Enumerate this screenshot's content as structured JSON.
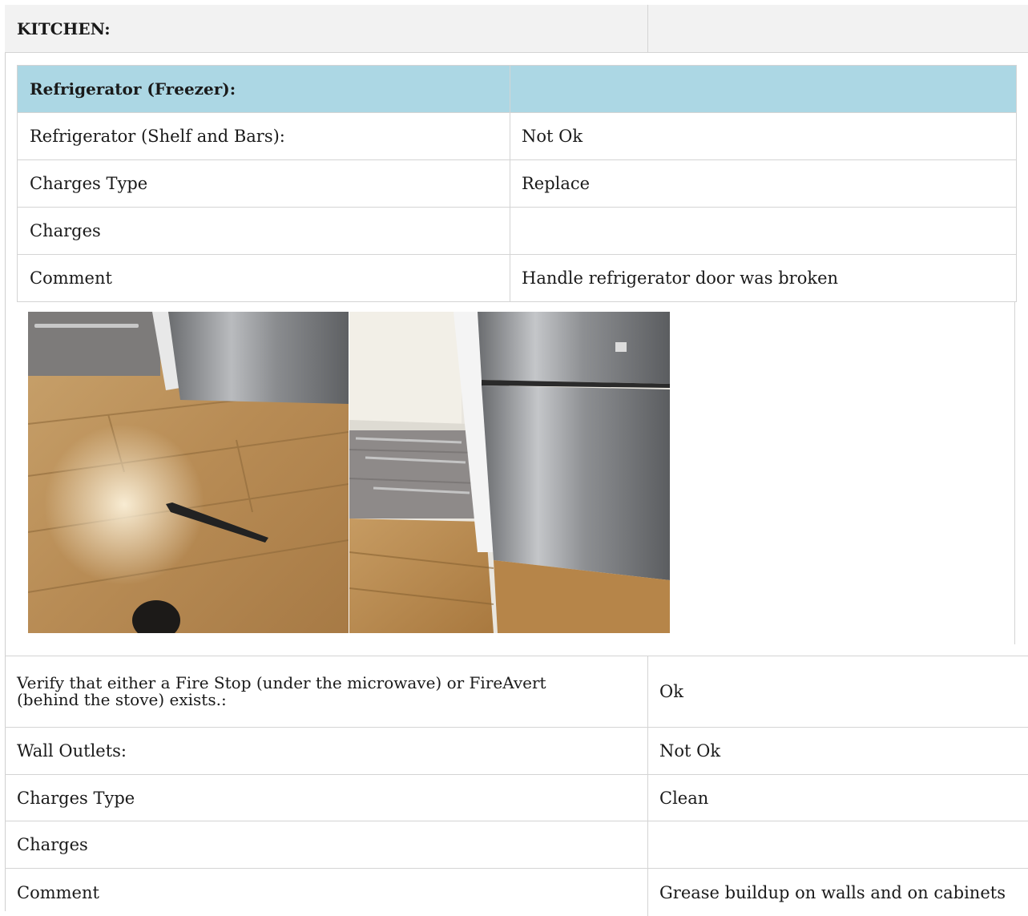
{
  "section": {
    "title": "KITCHEN:",
    "value": ""
  },
  "refrigerator": {
    "header": "Refrigerator (Freezer):",
    "header_value": "",
    "rows": [
      {
        "label": "Refrigerator (Shelf and Bars):",
        "value": "Not Ok"
      },
      {
        "label": "Charges Type",
        "value": "Replace"
      },
      {
        "label": "Charges",
        "value": ""
      },
      {
        "label": "Comment",
        "value": "Handle refrigerator door was broken"
      }
    ]
  },
  "items": [
    {
      "label": "Verify that either a Fire Stop (under the microwave) or FireAvert (behind the stove) exists.:",
      "value": "Ok"
    },
    {
      "label": "Wall Outlets:",
      "value": "Not Ok"
    },
    {
      "label": "Charges Type",
      "value": "Clean"
    },
    {
      "label": "Charges",
      "value": ""
    },
    {
      "label": "Comment",
      "value": "Grease buildup on walls and on cabinets"
    }
  ],
  "colors": {
    "header_gray": "#f2f2f2",
    "subheader_blue": "#acd7e4",
    "border": "#d4d4d4"
  }
}
